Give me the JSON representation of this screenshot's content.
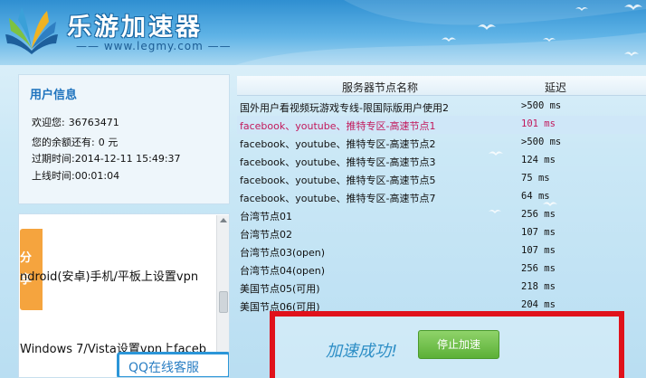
{
  "header": {
    "app_title": "乐游加速器",
    "url": "www.legmy.com"
  },
  "user_info": {
    "title": "用户信息",
    "welcome_label": "欢迎您:",
    "welcome_value": "36763471",
    "balance_label": "您的余额还有:",
    "balance_value": "0 元",
    "expire_label": "过期时间:",
    "expire_value": "2014-12-11 15:49:37",
    "online_label": "上线时间:",
    "online_value": "00:01:04"
  },
  "news": {
    "share_tab": "分享",
    "items": [
      "ndroid(安卓)手机/平板上设置vpn",
      "Windows 7/Vista设置vpn上faceb"
    ],
    "qq_button": "QQ在线客服"
  },
  "server_table": {
    "columns": [
      "服务器节点名称",
      "延迟"
    ],
    "rows": [
      {
        "name": "国外用户看视频玩游戏专线-限国际版用户使用2",
        "latency": ">500 ms",
        "selected": false
      },
      {
        "name": "facebook、youtube、推特专区-高速节点1",
        "latency": "101 ms",
        "selected": true
      },
      {
        "name": "facebook、youtube、推特专区-高速节点2",
        "latency": ">500 ms",
        "selected": false
      },
      {
        "name": "facebook、youtube、推特专区-高速节点3",
        "latency": "124 ms",
        "selected": false
      },
      {
        "name": "facebook、youtube、推特专区-高速节点5",
        "latency": "75 ms",
        "selected": false
      },
      {
        "name": "facebook、youtube、推特专区-高速节点7",
        "latency": "64 ms",
        "selected": false
      },
      {
        "name": "台湾节点01",
        "latency": "256 ms",
        "selected": false
      },
      {
        "name": "台湾节点02",
        "latency": "107 ms",
        "selected": false
      },
      {
        "name": "台湾节点03(open)",
        "latency": "107 ms",
        "selected": false
      },
      {
        "name": "台湾节点04(open)",
        "latency": "256 ms",
        "selected": false
      },
      {
        "name": "美国节点05(可用)",
        "latency": "218 ms",
        "selected": false
      },
      {
        "name": "美国节点06(可用)",
        "latency": "204 ms",
        "selected": false
      }
    ]
  },
  "status": {
    "message": "加速成功!",
    "stop_button": "停止加速"
  },
  "colors": {
    "accent": "#1e73be",
    "selected_text": "#c2185b",
    "status_border": "#e0121b",
    "stop_button": "#5cb037"
  }
}
